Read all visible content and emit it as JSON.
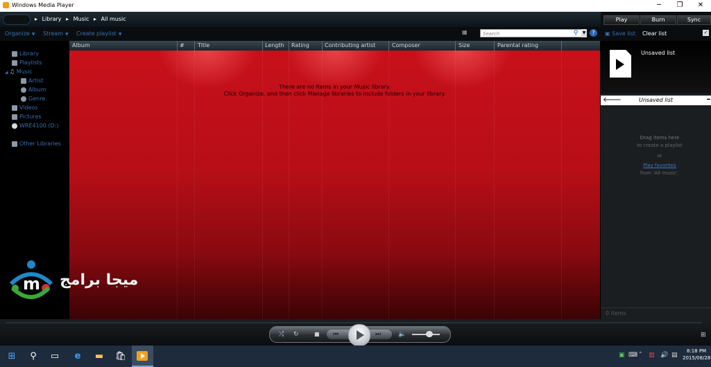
{
  "window": {
    "title": "Windows Media Player",
    "controls": [
      "─",
      "❐",
      "✕"
    ]
  },
  "breadcrumbs": [
    "Library",
    "Music",
    "All music"
  ],
  "tabs": [
    "Play",
    "Burn",
    "Sync"
  ],
  "toolbar": {
    "organize": "Organize",
    "stream": "Stream",
    "create_playlist": "Create playlist"
  },
  "search": {
    "placeholder": "Search"
  },
  "list_toolbar": {
    "save_list": "Save list",
    "clear_list": "Clear list"
  },
  "sidebar": {
    "items": [
      {
        "label": "Library"
      },
      {
        "label": "Playlists"
      },
      {
        "label": "Music"
      },
      {
        "label": "Artist"
      },
      {
        "label": "Album"
      },
      {
        "label": "Genre"
      },
      {
        "label": "Videos"
      },
      {
        "label": "Pictures"
      },
      {
        "label": "WRE4100 (D:)"
      },
      {
        "label": "Other Libraries"
      }
    ]
  },
  "columns": [
    "Album",
    "#",
    "Title",
    "Length",
    "Rating",
    "Contributing artist",
    "Composer",
    "Size",
    "Parental rating"
  ],
  "empty": {
    "line1": "There are no items in your Music library.",
    "line2": "Click Organize, and then click Manage libraries to include folders in your library."
  },
  "list_panel": {
    "title": "Unsaved list",
    "bar_title": "Unsaved list",
    "drag_title": "Drag items here",
    "drag_sub": "to create a playlist",
    "or": "or",
    "play_favorites": "Play favorites",
    "from": "from 'All music'.",
    "count": "0 items"
  },
  "watermark": {
    "text": "ميجا برامج"
  },
  "taskbar": {
    "time": "8:18 PM",
    "date": "2015/08/28"
  }
}
